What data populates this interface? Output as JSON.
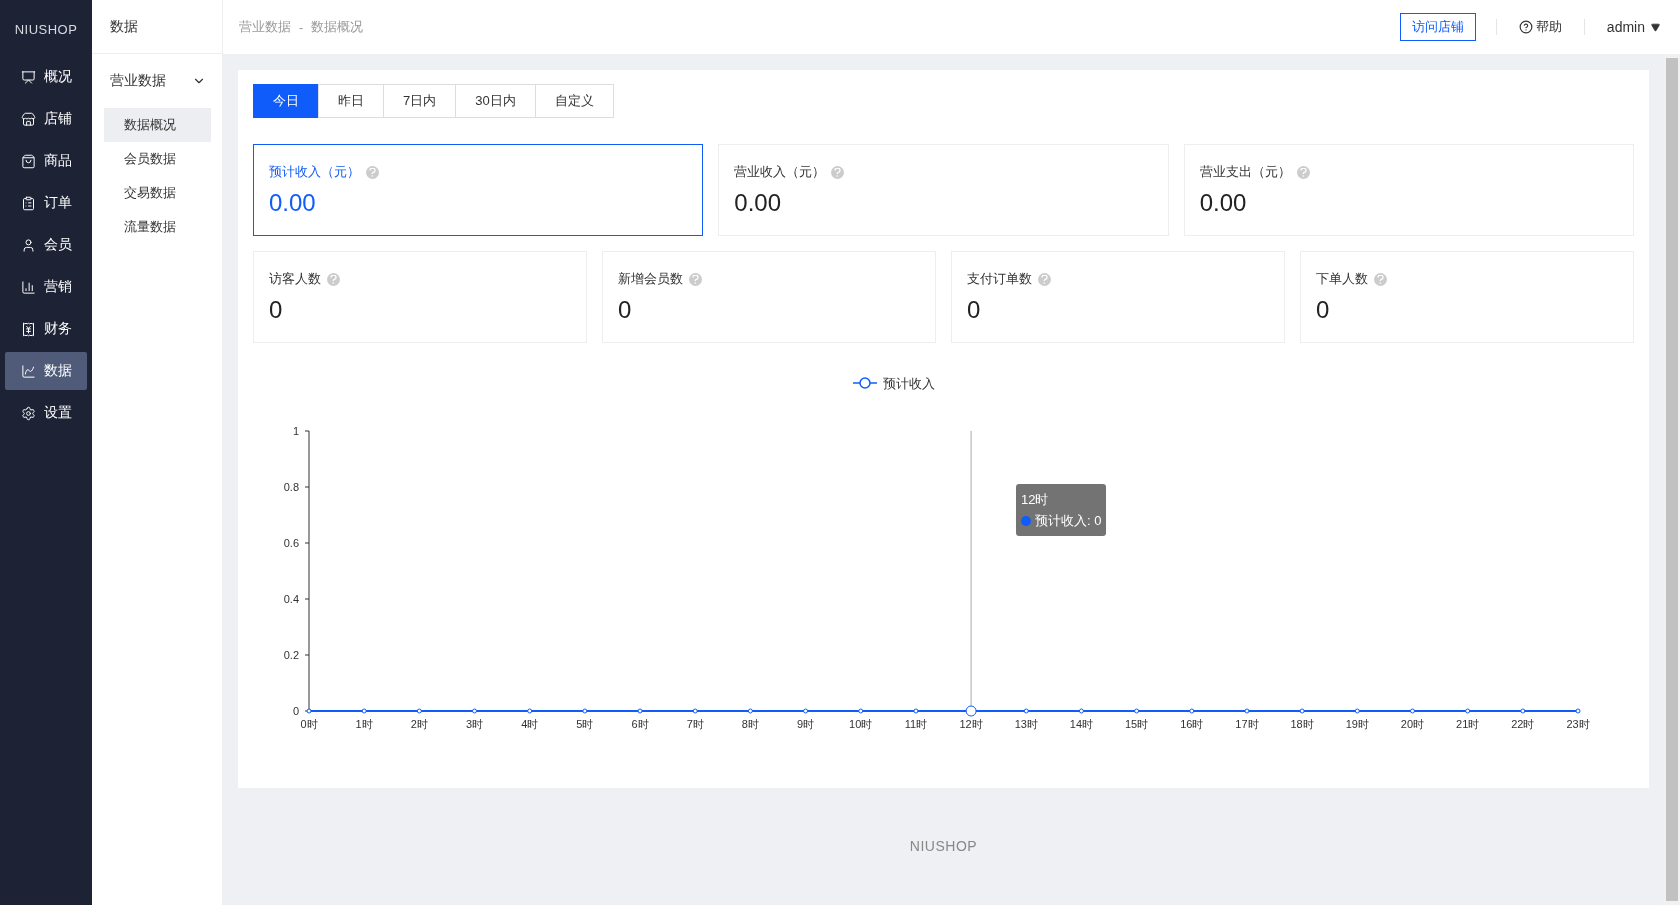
{
  "sidebar": {
    "logo": "NIUSHOP",
    "items": [
      {
        "label": "概况",
        "selected": false
      },
      {
        "label": "店铺",
        "selected": false
      },
      {
        "label": "商品",
        "selected": false
      },
      {
        "label": "订单",
        "selected": false
      },
      {
        "label": "会员",
        "selected": false
      },
      {
        "label": "营销",
        "selected": false
      },
      {
        "label": "财务",
        "selected": false
      },
      {
        "label": "数据",
        "selected": true
      },
      {
        "label": "设置",
        "selected": false
      }
    ]
  },
  "submenu": {
    "title": "数据",
    "groups": [
      {
        "label": "营业数据",
        "expanded": true,
        "children": [
          {
            "label": "数据概况",
            "selected": true
          },
          {
            "label": "会员数据",
            "selected": false
          },
          {
            "label": "交易数据",
            "selected": false
          },
          {
            "label": "流量数据",
            "selected": false
          }
        ]
      }
    ]
  },
  "header": {
    "breadcrumb": [
      "营业数据",
      "数据概况"
    ],
    "separator": "-",
    "visit_button": "访问店铺",
    "help": "帮助",
    "user": "admin"
  },
  "date_tabs": [
    {
      "label": "今日",
      "selected": true
    },
    {
      "label": "昨日",
      "selected": false
    },
    {
      "label": "7日内",
      "selected": false
    },
    {
      "label": "30日内",
      "selected": false
    },
    {
      "label": "自定义",
      "selected": false
    }
  ],
  "revenue_cards": [
    {
      "label": "预计收入（元）",
      "value": "0.00",
      "selected": true
    },
    {
      "label": "营业收入（元）",
      "value": "0.00",
      "selected": false
    },
    {
      "label": "营业支出（元）",
      "value": "0.00",
      "selected": false
    }
  ],
  "count_cards": [
    {
      "label": "访客人数",
      "value": "0"
    },
    {
      "label": "新增会员数",
      "value": "0"
    },
    {
      "label": "支付订单数",
      "value": "0"
    },
    {
      "label": "下单人数",
      "value": "0"
    }
  ],
  "chart": {
    "chart_data": {
      "type": "line",
      "categories": [
        "0时",
        "1时",
        "2时",
        "3时",
        "4时",
        "5时",
        "6时",
        "7时",
        "8时",
        "9时",
        "10时",
        "11时",
        "12时",
        "13时",
        "14时",
        "15时",
        "16时",
        "17时",
        "18时",
        "19时",
        "20时",
        "21时",
        "22时",
        "23时"
      ],
      "series": [
        {
          "name": "预计收入",
          "color": "#105cfb",
          "marker": "circle",
          "values": [
            0,
            0,
            0,
            0,
            0,
            0,
            0,
            0,
            0,
            0,
            0,
            0,
            0,
            0,
            0,
            0,
            0,
            0,
            0,
            0,
            0,
            0,
            0,
            0
          ]
        }
      ],
      "ylim": [
        0,
        1
      ],
      "yticks": [
        0,
        0.2,
        0.4,
        0.6,
        0.8,
        1
      ]
    },
    "tooltip": {
      "title": "12时",
      "text": "预计收入: 0"
    }
  },
  "footer": {
    "logo": "NIUSHOP"
  }
}
